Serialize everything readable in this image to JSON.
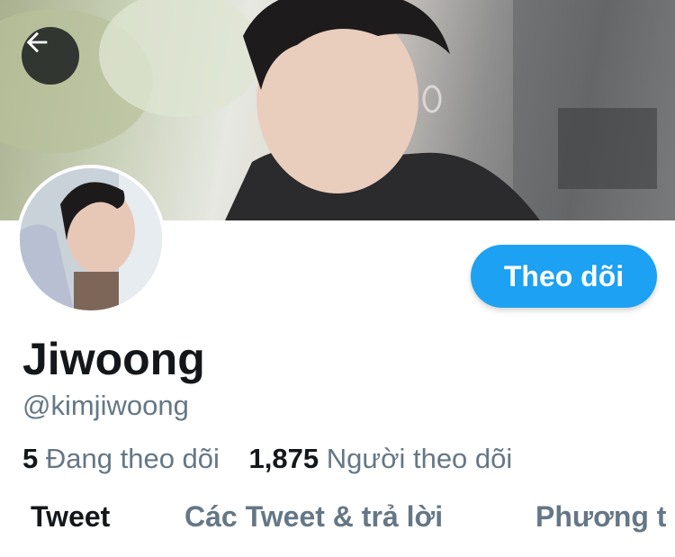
{
  "profile": {
    "name": "Jiwoong",
    "handle": "@kimjiwoong",
    "follow_label": "Theo dõi",
    "following_count": "5",
    "following_label": "Đang theo dõi",
    "followers_count": "1,875",
    "followers_label": "Người theo dõi"
  },
  "tabs": [
    {
      "label": "Tweet",
      "active": true
    },
    {
      "label": "Các Tweet & trả lời",
      "active": false
    },
    {
      "label": "Phương t",
      "active": false
    }
  ],
  "icons": {
    "back": "arrow-left-icon"
  },
  "colors": {
    "accent": "#1da1f2",
    "text_primary": "#14171a",
    "text_secondary": "#657786"
  }
}
